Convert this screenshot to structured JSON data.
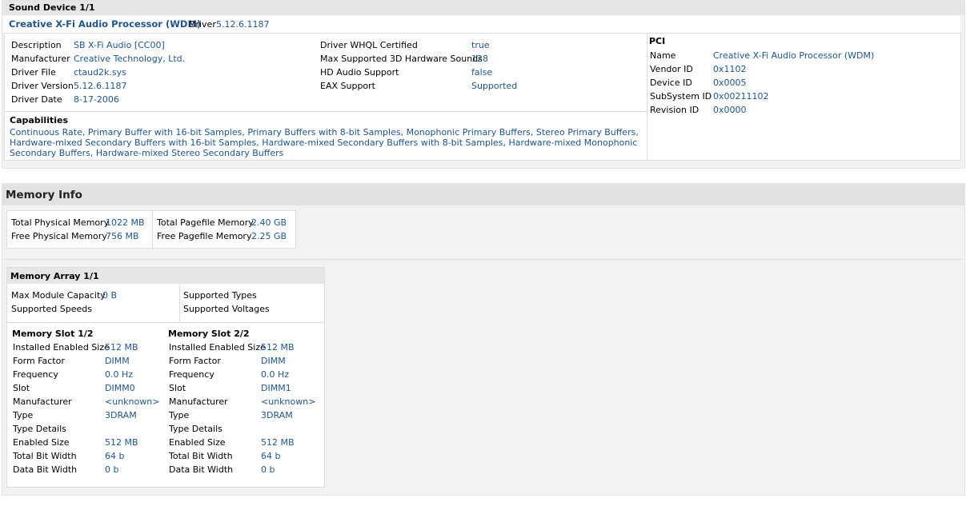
{
  "sound": {
    "header": "Sound Device 1/1",
    "device_name": "Creative X-Fi Audio Processor (WDM)",
    "driver_label": "Driver",
    "driver_version": "5.12.6.1187",
    "left_fields": [
      {
        "label": "Description",
        "value": "SB X-Fi Audio [CC00]"
      },
      {
        "label": "Manufacturer",
        "value": "Creative Technology, Ltd."
      },
      {
        "label": "Driver File",
        "value": "ctaud2k.sys"
      },
      {
        "label": "Driver Version",
        "value": "5.12.6.1187"
      },
      {
        "label": "Driver Date",
        "value": "8-17-2006"
      }
    ],
    "mid_fields": [
      {
        "label": "Driver WHQL Certified",
        "value": "true"
      },
      {
        "label": "Max Supported 3D Hardware Sounds",
        "value": "128"
      },
      {
        "label": "HD Audio Support",
        "value": "false"
      },
      {
        "label": "EAX Support",
        "value": "Supported"
      }
    ],
    "capabilities_title": "Capabilities",
    "capabilities_text": "Continuous Rate, Primary Buffer with 16-bit Samples, Primary Buffers with 8-bit Samples, Monophonic Primary Buffers, Stereo Primary Buffers, Hardware-mixed Secondary Buffers with 16-bit Samples, Hardware-mixed Secondary Buffers with 8-bit Samples, Hardware-mixed Monophonic Secondary Buffers, Hardware-mixed Stereo Secondary Buffers",
    "pci_title": "PCI",
    "pci_fields": [
      {
        "label": "Name",
        "value": "Creative X-Fi Audio Processor (WDM)"
      },
      {
        "label": "Vendor ID",
        "value": "0x1102"
      },
      {
        "label": "Device ID",
        "value": "0x0005"
      },
      {
        "label": "SubSystem ID",
        "value": "0x00211102"
      },
      {
        "label": "Revision ID",
        "value": "0x0000"
      }
    ]
  },
  "memory": {
    "header": "Memory Info",
    "info_left": [
      {
        "label": "Total Physical Memory",
        "value": "1022 MB"
      },
      {
        "label": "Free Physical Memory",
        "value": "756 MB"
      }
    ],
    "info_right": [
      {
        "label": "Total Pagefile Memory",
        "value": "2.40 GB"
      },
      {
        "label": "Free Pagefile Memory",
        "value": "2.25 GB"
      }
    ],
    "array": {
      "header": "Memory Array 1/1",
      "left": [
        {
          "label": "Max Module Capacity",
          "value": "0 B"
        },
        {
          "label": "Supported Speeds",
          "value": ""
        }
      ],
      "right": [
        {
          "label": "Supported Types",
          "value": ""
        },
        {
          "label": "Supported Voltages",
          "value": ""
        }
      ],
      "slots": [
        {
          "title": "Memory Slot 1/2",
          "fields": [
            {
              "label": "Installed Enabled Size",
              "value": "512 MB"
            },
            {
              "label": "Form Factor",
              "value": "DIMM"
            },
            {
              "label": "Frequency",
              "value": "0.0 Hz"
            },
            {
              "label": "Slot",
              "value": "DIMM0"
            },
            {
              "label": "Manufacturer",
              "value": "<unknown>"
            },
            {
              "label": "Type",
              "value": "3DRAM"
            },
            {
              "label": "Type Details",
              "value": ""
            },
            {
              "label": "Enabled Size",
              "value": "512 MB"
            },
            {
              "label": "Total Bit Width",
              "value": "64 b"
            },
            {
              "label": "Data Bit Width",
              "value": "0 b"
            }
          ]
        },
        {
          "title": "Memory Slot 2/2",
          "fields": [
            {
              "label": "Installed Enabled Size",
              "value": "512 MB"
            },
            {
              "label": "Form Factor",
              "value": "DIMM"
            },
            {
              "label": "Frequency",
              "value": "0.0 Hz"
            },
            {
              "label": "Slot",
              "value": "DIMM1"
            },
            {
              "label": "Manufacturer",
              "value": "<unknown>"
            },
            {
              "label": "Type",
              "value": "3DRAM"
            },
            {
              "label": "Type Details",
              "value": ""
            },
            {
              "label": "Enabled Size",
              "value": "512 MB"
            },
            {
              "label": "Total Bit Width",
              "value": "64 b"
            },
            {
              "label": "Data Bit Width",
              "value": "0 b"
            }
          ]
        }
      ]
    }
  }
}
